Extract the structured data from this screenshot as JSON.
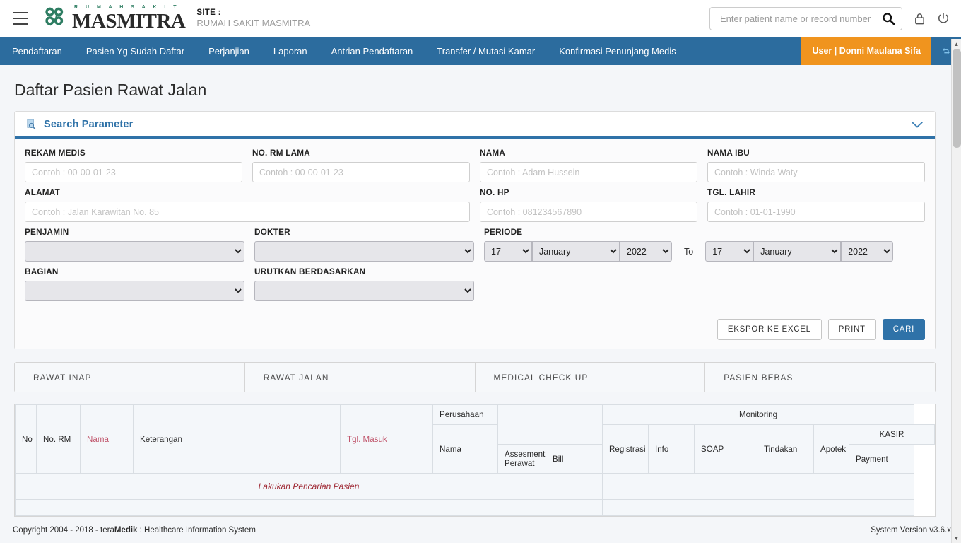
{
  "header": {
    "menu_icon": "hamburger-icon",
    "brand_sub": "R U M A H   S A K I T",
    "brand_name": "MASMITRA",
    "site_label": "SITE :",
    "site_value": "RUMAH SAKIT MASMITRA",
    "search_placeholder": "Enter patient name or record number",
    "search_value": "",
    "search_icon": "search-icon",
    "lock_icon": "lock-icon",
    "power_icon": "power-icon"
  },
  "nav": {
    "items": [
      {
        "label": "Pendaftaran"
      },
      {
        "label": "Pasien Yg Sudah Daftar"
      },
      {
        "label": "Perjanjian"
      },
      {
        "label": "Laporan"
      },
      {
        "label": "Antrian Pendaftaran"
      },
      {
        "label": "Transfer / Mutasi Kamar"
      },
      {
        "label": "Konfirmasi Penunjang Medis"
      }
    ],
    "user_label": "User | Donni Maulana Sifa",
    "refresh_icon": "refresh-icon"
  },
  "page": {
    "title": "Daftar Pasien Rawat Jalan"
  },
  "search_panel": {
    "icon": "search-document-icon",
    "title": "Search Parameter",
    "chevron_icon": "chevron-down-icon",
    "fields": {
      "rekam_medis": {
        "label": "REKAM MEDIS",
        "placeholder": "Contoh : 00-00-01-23",
        "value": ""
      },
      "no_rm_lama": {
        "label": "NO. RM LAMA",
        "placeholder": "Contoh : 00-00-01-23",
        "value": ""
      },
      "nama": {
        "label": "NAMA",
        "placeholder": "Contoh : Adam Hussein",
        "value": ""
      },
      "nama_ibu": {
        "label": "NAMA IBU",
        "placeholder": "Contoh : Winda Waty",
        "value": ""
      },
      "alamat": {
        "label": "ALAMAT",
        "placeholder": "Contoh : Jalan Karawitan No. 85",
        "value": ""
      },
      "no_hp": {
        "label": "NO. HP",
        "placeholder": "Contoh : 081234567890",
        "value": ""
      },
      "tgl_lahir": {
        "label": "TGL. LAHIR",
        "placeholder": "Contoh : 01-01-1990",
        "value": ""
      },
      "penjamin": {
        "label": "PENJAMIN",
        "value": ""
      },
      "dokter": {
        "label": "DOKTER",
        "value": ""
      },
      "bagian": {
        "label": "BAGIAN",
        "value": ""
      },
      "urutkan": {
        "label": "URUTKAN BERDASARKAN",
        "value": ""
      },
      "periode": {
        "label": "PERIODE",
        "to_label": "To",
        "from": {
          "day": "17",
          "month": "January",
          "year": "2022"
        },
        "until": {
          "day": "17",
          "month": "January",
          "year": "2022"
        }
      }
    },
    "buttons": {
      "export": "EKSPOR KE EXCEL",
      "print": "PRINT",
      "search": "CARI"
    }
  },
  "tabs": [
    {
      "label": "RAWAT INAP"
    },
    {
      "label": "RAWAT JALAN"
    },
    {
      "label": "MEDICAL CHECK UP"
    },
    {
      "label": "PASIEN BEBAS"
    }
  ],
  "table": {
    "headers": {
      "no": "No",
      "no_rm": "No. RM",
      "nama": "Nama",
      "keterangan": "Keterangan",
      "tgl_masuk": "Tgl. Masuk",
      "perusahaan": "Perusahaan",
      "perusahaan_nama": "Nama",
      "assesment_perawat": "Assesment Perawat",
      "monitoring": "Monitoring",
      "registrasi": "Registrasi",
      "info": "Info",
      "soap": "SOAP",
      "tindakan": "Tindakan",
      "apotek": "Apotek",
      "kasir": "KASIR",
      "bill": "Bill",
      "payment": "Payment"
    },
    "empty_message": "Lakukan Pencarian Pasien",
    "rows": []
  },
  "footer": {
    "copyright_prefix": "Copyright 2004 - 2018 - tera",
    "copyright_brand": "Medik",
    "copyright_suffix": " : Healthcare Information System",
    "version": "System Version v3.6.x"
  },
  "colors": {
    "nav_blue": "#2c6c9e",
    "accent_orange": "#f0941e",
    "brand_green": "#2e7d62",
    "link_red": "#c0556b",
    "empty_red": "#a02b36"
  }
}
